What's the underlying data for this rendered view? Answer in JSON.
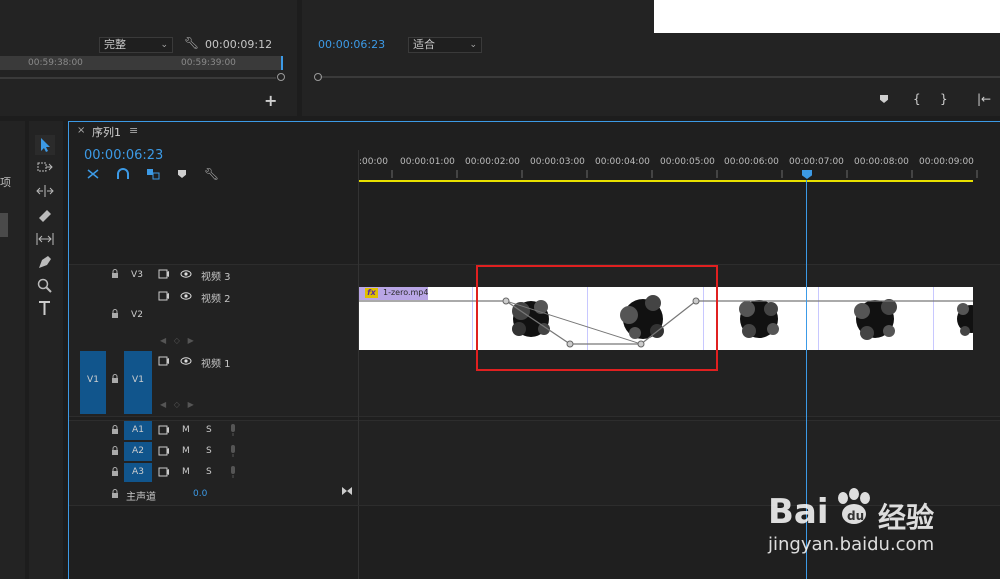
{
  "source_monitor": {
    "quality": "完整",
    "timecode": "00:00:09:12",
    "ruler": [
      "00:59:38:00",
      "00:59:39:00"
    ],
    "add_label": "+"
  },
  "program_monitor": {
    "timecode": "00:00:06:23",
    "fit": "适合",
    "controls": [
      "{",
      "}",
      "|←"
    ]
  },
  "left_panel": {
    "partial_label": "项"
  },
  "sequence": {
    "close": "×",
    "name": "序列1",
    "menu": "≡",
    "timecode": "00:00:06:23"
  },
  "ruler": {
    "ticks": [
      ":00:00",
      "00:00:01:00",
      "00:00:02:00",
      "00:00:03:00",
      "00:00:04:00",
      "00:00:05:00",
      "00:00:06:00",
      "00:00:07:00",
      "00:00:08:00",
      "00:00:09:00"
    ]
  },
  "tracks": {
    "video": [
      {
        "id": "V3",
        "name": "视频 3"
      },
      {
        "id": "V2",
        "name": "视频 2"
      },
      {
        "id": "V1",
        "name": "视频 1",
        "source": "V1"
      }
    ],
    "audio": [
      {
        "id": "A1",
        "m": "M",
        "s": "S"
      },
      {
        "id": "A2",
        "m": "M",
        "s": "S"
      },
      {
        "id": "A3",
        "m": "M",
        "s": "S"
      }
    ],
    "master": {
      "name": "主声道",
      "value": "0.0"
    }
  },
  "clip": {
    "fx": "fx",
    "name": "1-zero.mp4"
  },
  "watermark": {
    "brand": "Bai",
    "brand2": "经验",
    "url": "jingyan.baidu.com"
  },
  "colors": {
    "accent": "#3c9ae6",
    "track_target": "#11558c",
    "highlight": "#e02020",
    "work_area": "#e8e000"
  },
  "icons": [
    "selection-tool-icon",
    "track-select-tool-icon",
    "ripple-edit-tool-icon",
    "razor-tool-icon",
    "slip-tool-icon",
    "pen-tool-icon",
    "zoom-tool-icon",
    "type-tool-icon",
    "wrench-icon",
    "snap-icon",
    "linked-selection-icon",
    "add-marker-icon",
    "lock-icon",
    "eye-icon",
    "film-icon",
    "mic-icon"
  ]
}
